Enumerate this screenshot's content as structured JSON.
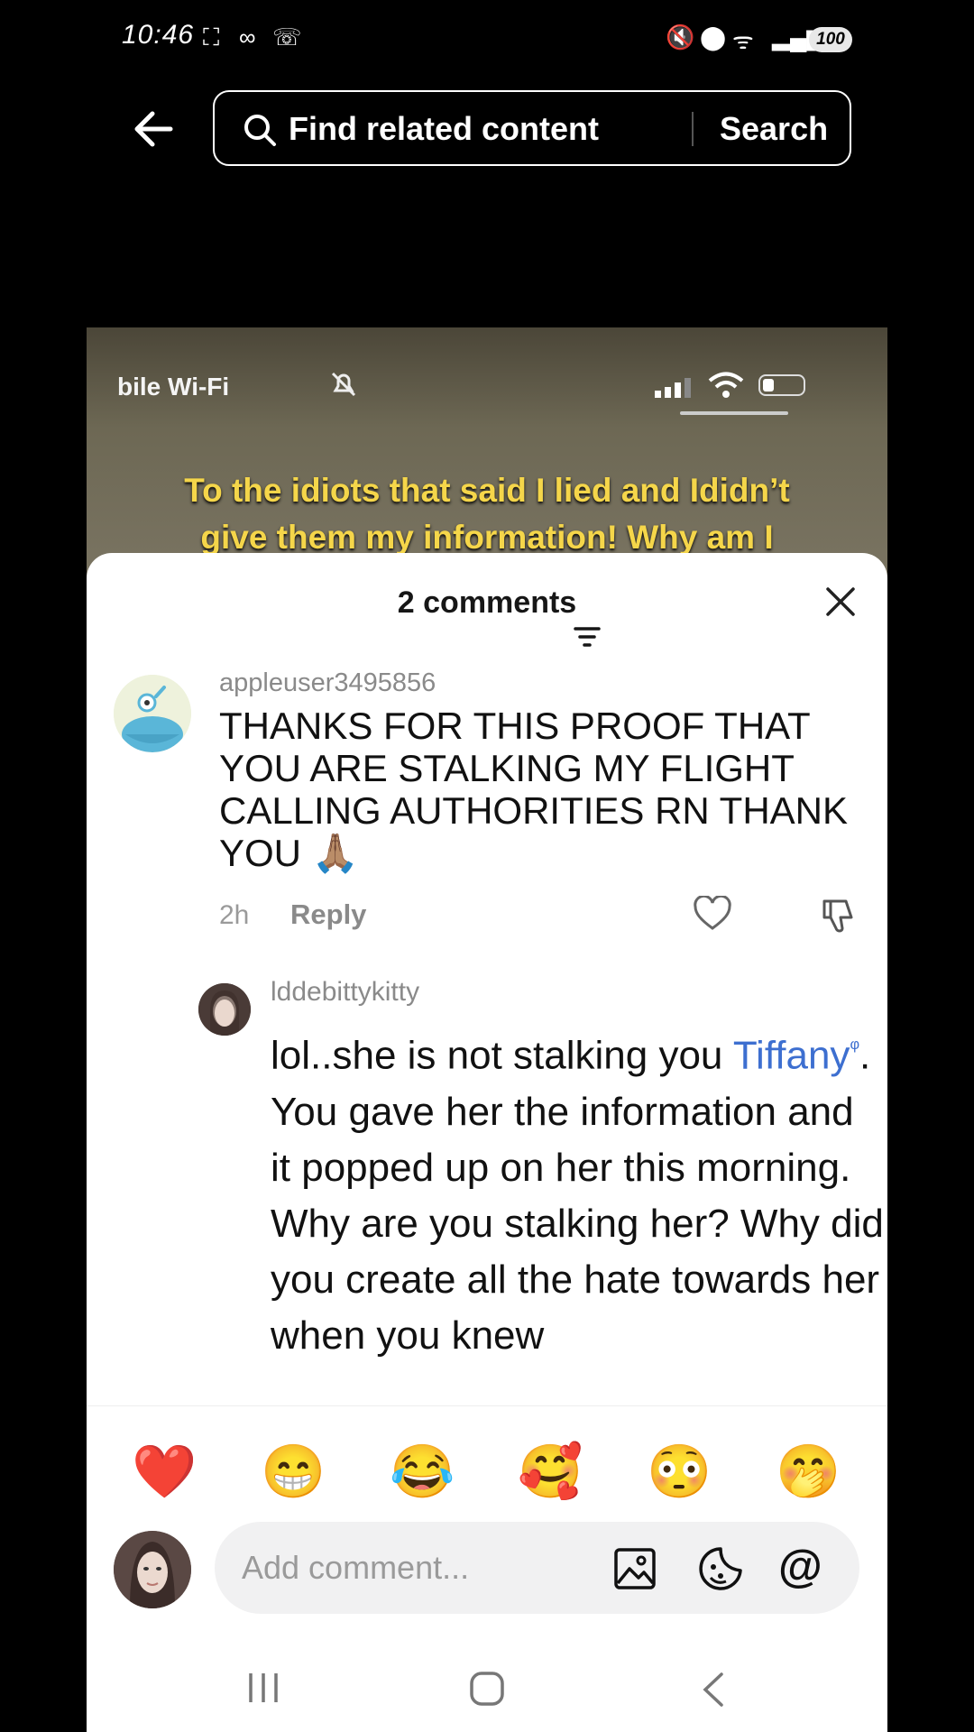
{
  "status_bar": {
    "time": "10:46",
    "battery": "100"
  },
  "search": {
    "placeholder": "Find related content",
    "button": "Search"
  },
  "video": {
    "status_text": "bile Wi-Fi",
    "caption_line1": "To the idiots that said I lied and Ididn’t",
    "caption_line2": "give them my information! Why am I"
  },
  "comments": {
    "title": "2 comments",
    "items": [
      {
        "username": "appleuser3495856",
        "text": "THANKS FOR THIS PROOF THAT YOU ARE STALKING MY FLIGHT CALLING AUTHORITIES RN THANK YOU",
        "emoji": "🙏🏽",
        "time": "2h",
        "reply": "Reply"
      },
      {
        "username": "lddebittykitty",
        "text_before": "lol..she is not stalking you ",
        "mention": "Tiffany",
        "text_after": ". You gave her the information and it popped up on her this morning. Why are you stalking her? Why did you create all the hate towards her when you knew"
      }
    ]
  },
  "reactions": [
    "❤️",
    "😁",
    "😂",
    "🥰",
    "😳",
    "🤭"
  ],
  "input": {
    "placeholder": "Add comment...",
    "at_symbol": "@"
  }
}
